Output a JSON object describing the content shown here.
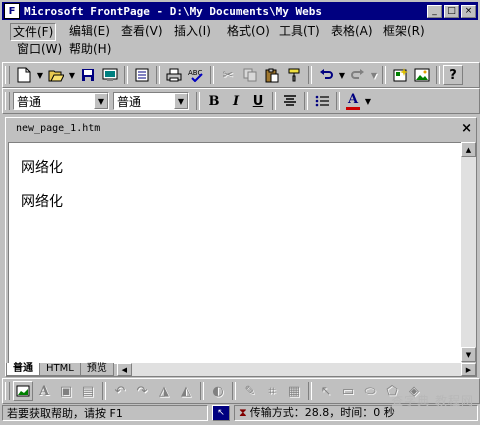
{
  "window": {
    "title": "Microsoft FrontPage - D:\\My Documents\\My Webs",
    "controls": [
      "_",
      "□",
      "×"
    ]
  },
  "menus": [
    {
      "label": "文件(F)",
      "active": true
    },
    {
      "label": "编辑(E)"
    },
    {
      "label": "查看(V)"
    },
    {
      "label": "插入(I)"
    },
    {
      "label": "格式(O)"
    },
    {
      "label": "工具(T)"
    },
    {
      "label": "表格(A)"
    },
    {
      "label": "框架(R)"
    },
    {
      "label": "窗口(W)"
    },
    {
      "label": "帮助(H)"
    }
  ],
  "toolbar_standard": {
    "icons": [
      "new-page-icon",
      "open-icon",
      "save-icon",
      "publish-icon",
      "folder-list-icon",
      "print-icon",
      "spelling-icon",
      "cut-icon",
      "copy-icon",
      "paste-icon",
      "format-painter-icon",
      "undo-icon",
      "redo-icon",
      "web-component-icon",
      "insert-picture-icon",
      "help-icon"
    ]
  },
  "toolbar_format": {
    "style_value": "普通",
    "font_value": "普通",
    "bold": "B",
    "italic": "I",
    "underline": "U",
    "font_color_letter": "A",
    "font_color": "#cc0000"
  },
  "document": {
    "tab_name": "new_page_1.htm",
    "close": "×",
    "paragraphs": [
      "网络化",
      "网络化"
    ]
  },
  "view_tabs": [
    "普通",
    "HTML",
    "预览"
  ],
  "status": {
    "help_text": "若要获取帮助，请按 F1",
    "transfer_text": "传输方式：28.8，时间：0 秒"
  },
  "watermark": "查字典 教程网"
}
